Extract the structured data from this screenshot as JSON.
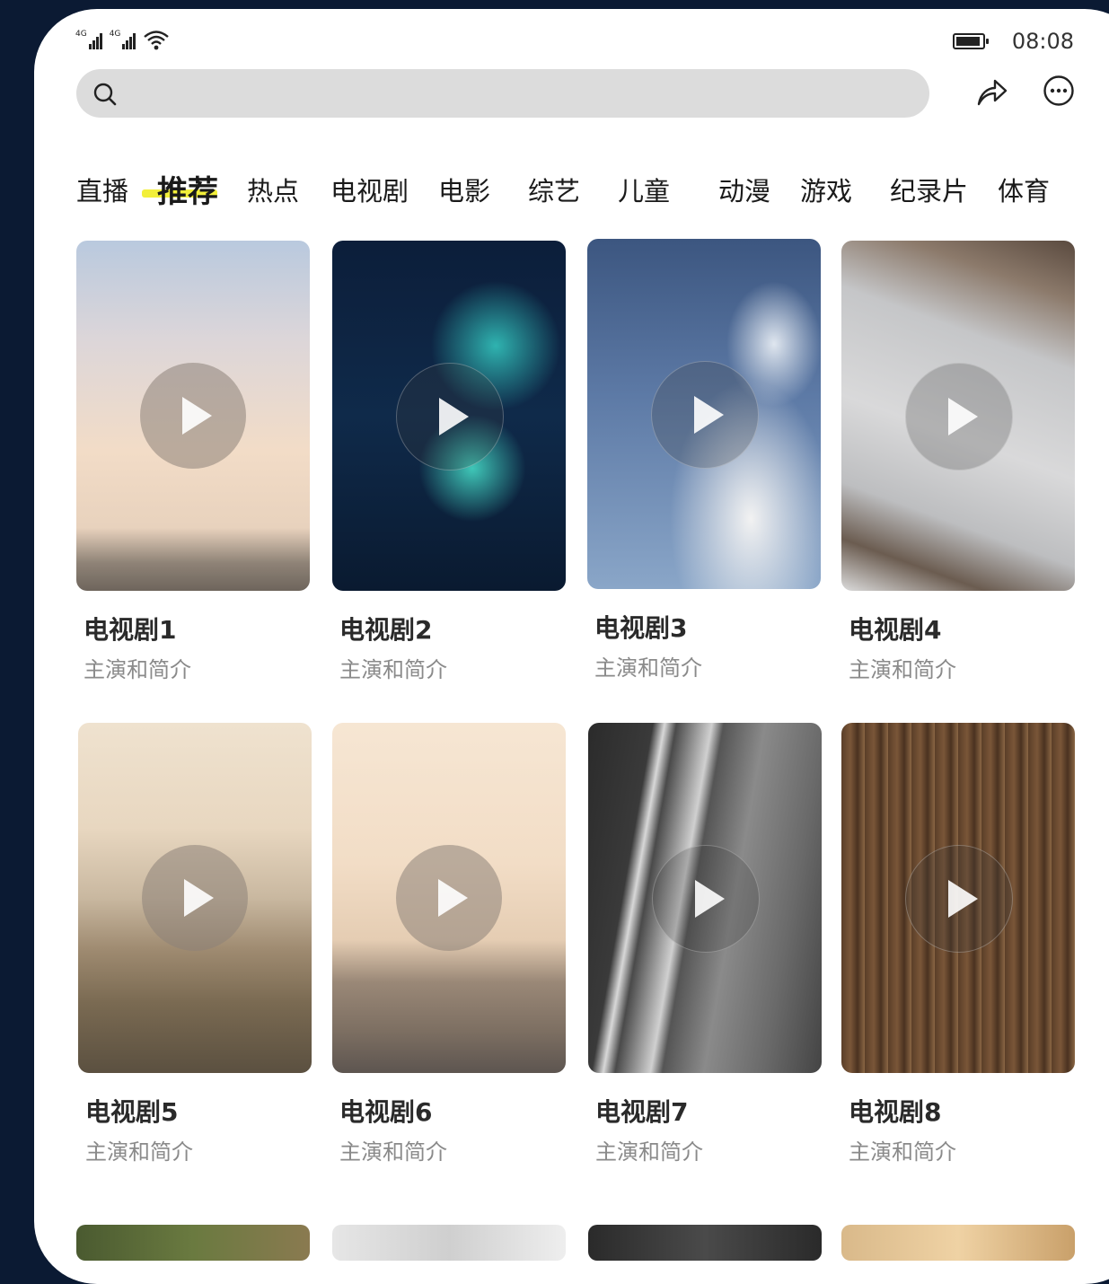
{
  "status_bar": {
    "signal1_label": "4G",
    "signal2_label": "4G",
    "icons": [
      "signal-icon",
      "signal-icon",
      "wifi-icon",
      "battery-icon"
    ],
    "time": "08:08"
  },
  "search": {
    "placeholder": ""
  },
  "header_icons": [
    "search-icon",
    "share-icon",
    "more-icon"
  ],
  "tabs": [
    {
      "label": "直播"
    },
    {
      "label": "推荐",
      "active": true
    },
    {
      "label": "热点"
    },
    {
      "label": "电视剧"
    },
    {
      "label": "电影"
    },
    {
      "label": "综艺"
    },
    {
      "label": "儿童"
    },
    {
      "label": "动漫"
    },
    {
      "label": "游戏"
    },
    {
      "label": "纪录片"
    },
    {
      "label": "体育"
    }
  ],
  "accent_color": "#f2ef3a",
  "cards": [
    {
      "title": "电视剧1",
      "subtitle": "主演和简介"
    },
    {
      "title": "电视剧2",
      "subtitle": "主演和简介"
    },
    {
      "title": "电视剧3",
      "subtitle": "主演和简介"
    },
    {
      "title": "电视剧4",
      "subtitle": "主演和简介"
    },
    {
      "title": "电视剧5",
      "subtitle": "主演和简介"
    },
    {
      "title": "电视剧6",
      "subtitle": "主演和简介"
    },
    {
      "title": "电视剧7",
      "subtitle": "主演和简介"
    },
    {
      "title": "电视剧8",
      "subtitle": "主演和简介"
    }
  ]
}
